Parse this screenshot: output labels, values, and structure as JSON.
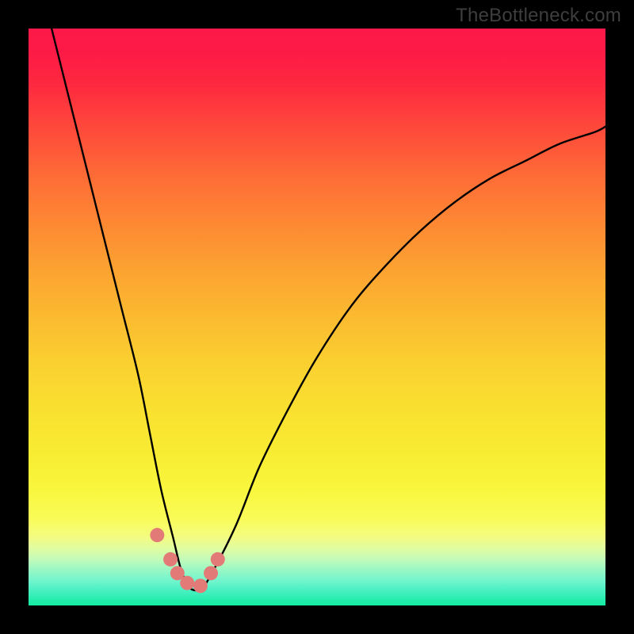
{
  "watermark": "TheBottleneck.com",
  "chart_data": {
    "type": "line",
    "title": "",
    "xlabel": "",
    "ylabel": "",
    "xlim": [
      0,
      100
    ],
    "ylim": [
      0,
      100
    ],
    "grid": false,
    "legend": false,
    "note": "Axes are unlabeled percentage scales inferred from pixel positions; values are estimates read off the image.",
    "series": [
      {
        "name": "bottleneck-curve",
        "color": "#000000",
        "x": [
          4,
          7,
          10,
          13,
          16,
          19,
          21,
          23,
          25,
          26.5,
          28,
          30,
          32,
          36,
          40,
          45,
          50,
          56,
          62,
          68,
          74,
          80,
          86,
          92,
          98,
          100
        ],
        "y": [
          100,
          88,
          76,
          64,
          52,
          40,
          30,
          20,
          12,
          6,
          3,
          3,
          6,
          14,
          24,
          34,
          43,
          52,
          59,
          65,
          70,
          74,
          77,
          80,
          82,
          83
        ]
      }
    ],
    "markers": [
      {
        "name": "dot-1",
        "x": 22.3,
        "y": 12.2
      },
      {
        "name": "dot-2",
        "x": 24.6,
        "y": 8.0
      },
      {
        "name": "dot-3",
        "x": 25.8,
        "y": 5.6
      },
      {
        "name": "dot-4",
        "x": 27.5,
        "y": 3.9
      },
      {
        "name": "dot-5",
        "x": 29.8,
        "y": 3.4
      },
      {
        "name": "dot-6",
        "x": 31.6,
        "y": 5.6
      },
      {
        "name": "dot-7",
        "x": 32.8,
        "y": 8.0
      }
    ],
    "marker_color": "#e27b77",
    "marker_radius": 9
  }
}
